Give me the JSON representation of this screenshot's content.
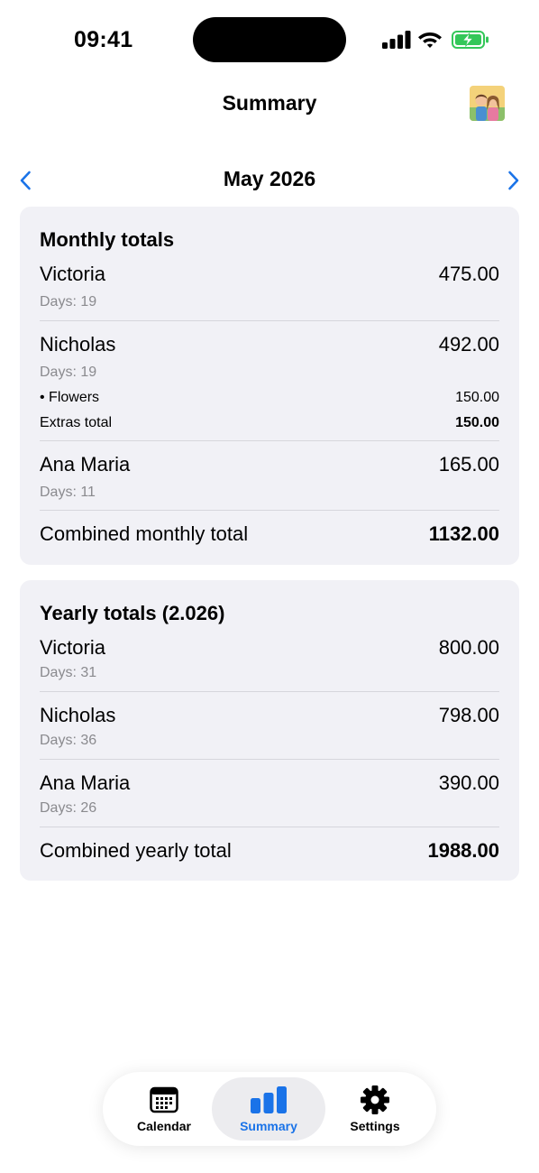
{
  "status_bar": {
    "time": "09:41"
  },
  "header": {
    "title": "Summary"
  },
  "month_nav": {
    "label": "May 2026"
  },
  "monthly": {
    "heading": "Monthly totals",
    "people": [
      {
        "name": "Victoria",
        "amount": "475.00",
        "days": "Days: 19"
      },
      {
        "name": "Nicholas",
        "amount": "492.00",
        "days": "Days: 19",
        "extras": [
          {
            "label": "• Flowers",
            "amount": "150.00"
          }
        ],
        "extras_total_label": "Extras total",
        "extras_total": "150.00"
      },
      {
        "name": "Ana Maria",
        "amount": "165.00",
        "days": "Days: 11"
      }
    ],
    "combined_label": "Combined monthly total",
    "combined_value": "1132.00"
  },
  "yearly": {
    "heading": "Yearly totals (2.026)",
    "people": [
      {
        "name": "Victoria",
        "amount": "800.00",
        "days": "Days: 31"
      },
      {
        "name": "Nicholas",
        "amount": "798.00",
        "days": "Days: 36"
      },
      {
        "name": "Ana Maria",
        "amount": "390.00",
        "days": "Days: 26"
      }
    ],
    "combined_label": "Combined yearly total",
    "combined_value": "1988.00"
  },
  "tabbar": {
    "tabs": [
      {
        "label": "Calendar",
        "icon": "calendar-icon"
      },
      {
        "label": "Summary",
        "icon": "bar-chart-icon"
      },
      {
        "label": "Settings",
        "icon": "gear-icon"
      }
    ],
    "active_index": 1
  },
  "colors": {
    "accent": "#1a73e8",
    "card_bg": "#f1f1f6",
    "secondary_text": "#8a8a8e",
    "battery": "#34c759"
  }
}
